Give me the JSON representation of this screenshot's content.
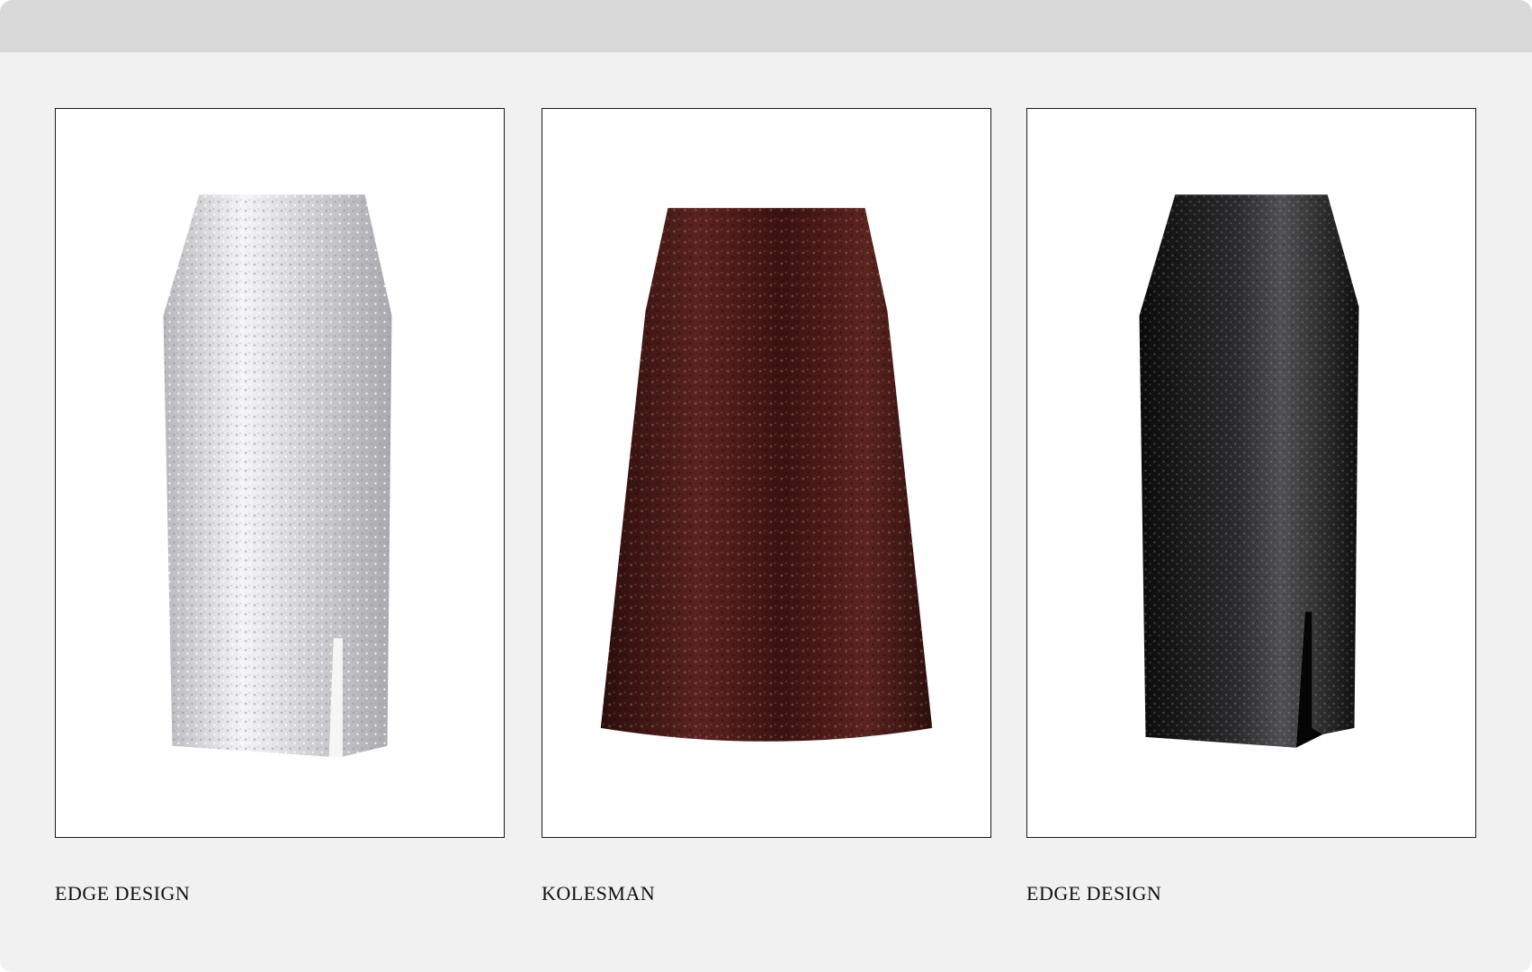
{
  "products": [
    {
      "brand": "EDGE DESIGN",
      "image": "silver sequin midi skirt with front slit",
      "color": "#c9c9cc"
    },
    {
      "brand": "KOLESMAN",
      "image": "burgundy sequin a-line midi skirt",
      "color": "#4a1a16"
    },
    {
      "brand": "EDGE DESIGN",
      "image": "black sequin midi skirt with front slit",
      "color": "#151515"
    }
  ],
  "theme": {
    "background": "#f1f1f1",
    "top_bar": "#d9d9d9",
    "card_border": "#1a1a1a"
  }
}
